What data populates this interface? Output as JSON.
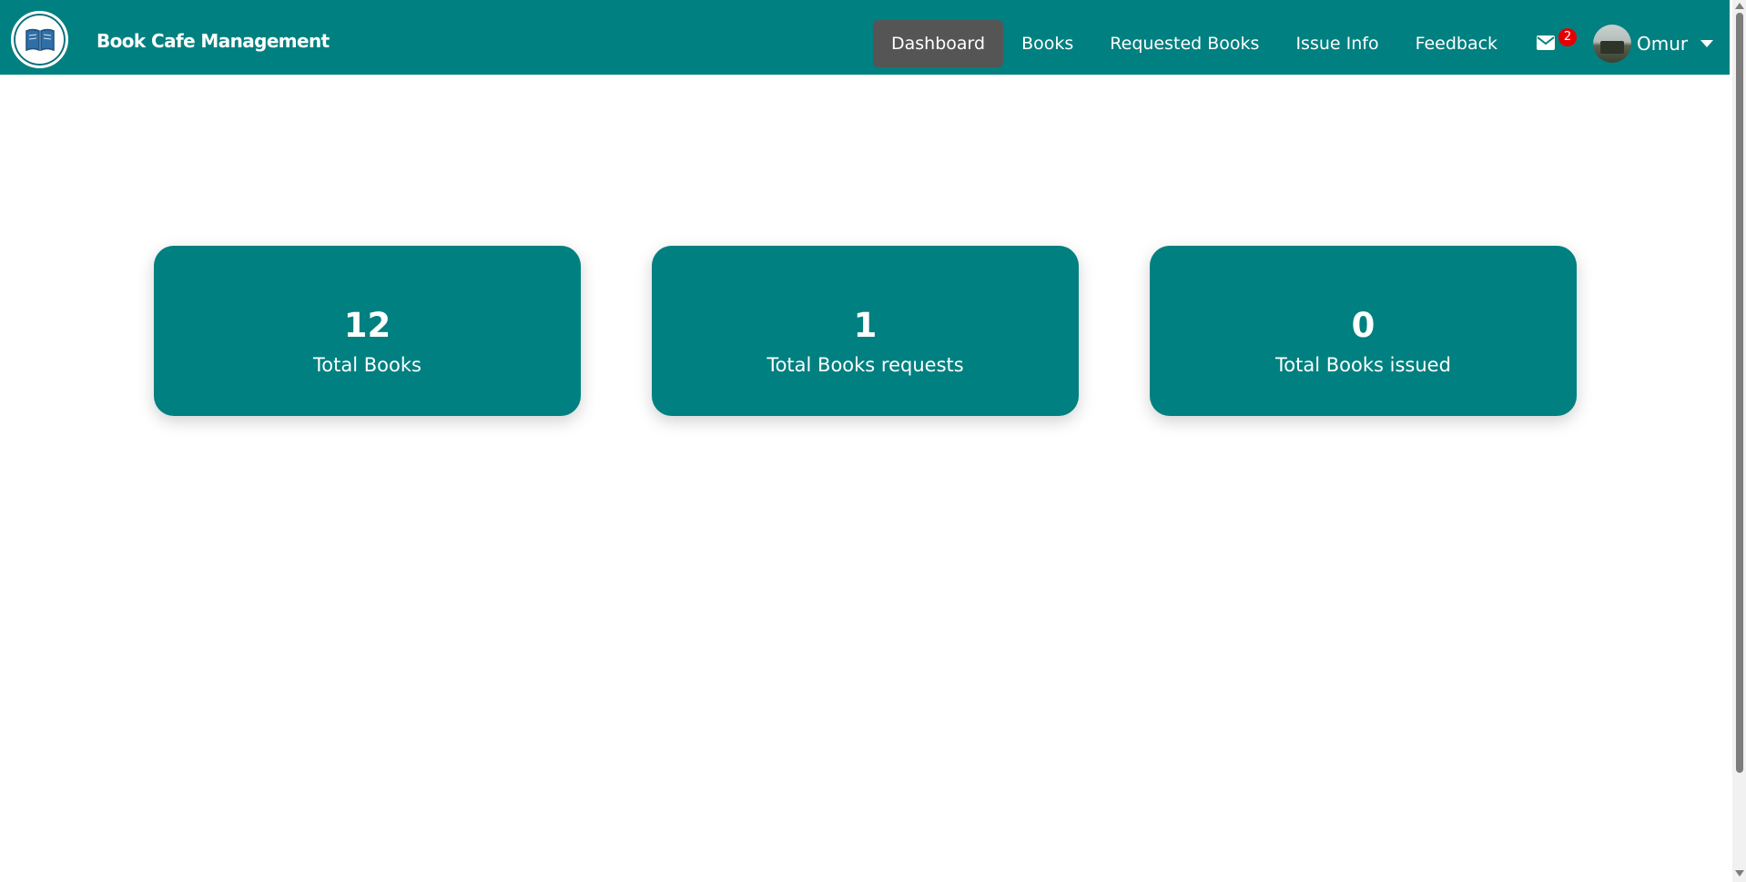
{
  "brand": {
    "name": "Book Cafe Management",
    "logo_icon": "book-icon"
  },
  "nav": {
    "items": [
      {
        "label": "Dashboard",
        "active": true
      },
      {
        "label": "Books",
        "active": false
      },
      {
        "label": "Requested Books",
        "active": false
      },
      {
        "label": "Issue Info",
        "active": false
      },
      {
        "label": "Feedback",
        "active": false
      }
    ]
  },
  "messages": {
    "icon": "envelope-icon",
    "count": "2"
  },
  "user": {
    "name": "Omur",
    "caret_icon": "caret-down-icon"
  },
  "stats": [
    {
      "value": "12",
      "label": "Total Books"
    },
    {
      "value": "1",
      "label": "Total Books requests"
    },
    {
      "value": "0",
      "label": "Total Books issued"
    }
  ],
  "colors": {
    "primary": "#008080",
    "active_nav": "#555555",
    "badge": "#e50000"
  }
}
